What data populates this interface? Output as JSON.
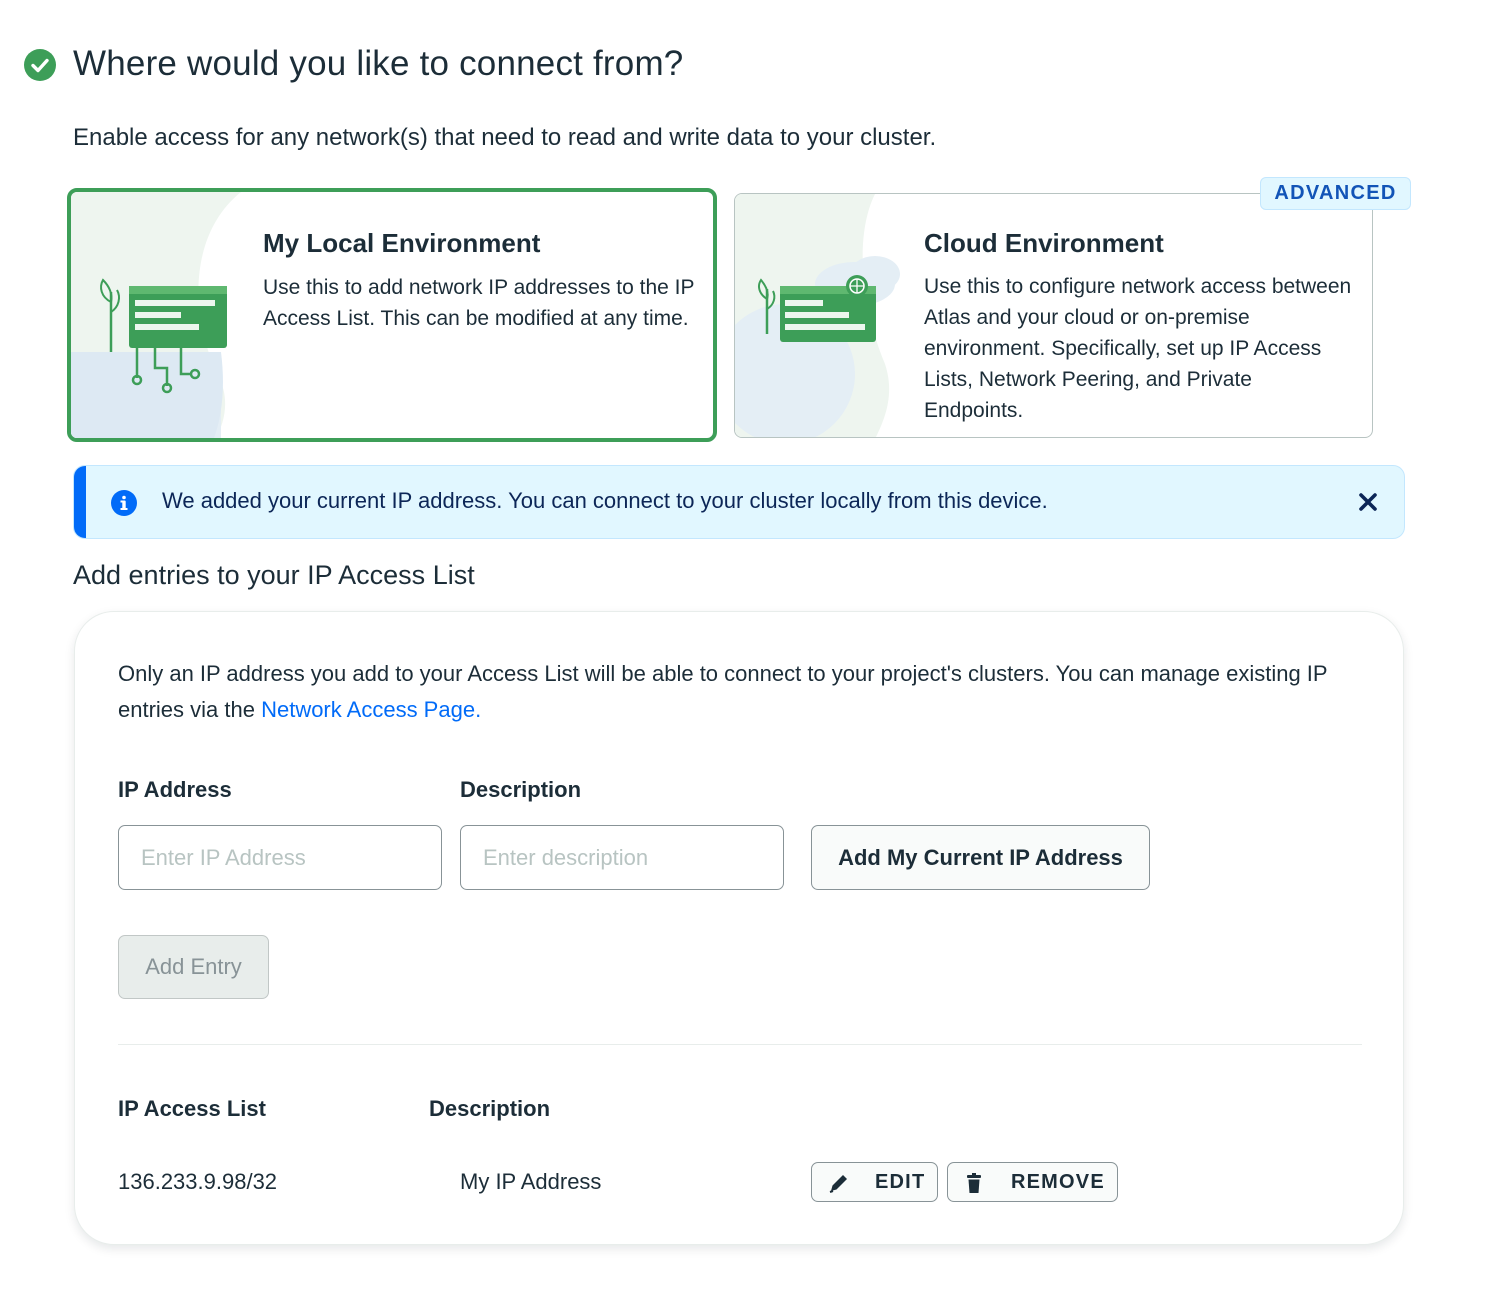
{
  "header": {
    "title": "Where would you like to connect from?",
    "subtitle": "Enable access for any network(s) that need to read and write data to your cluster."
  },
  "environments": [
    {
      "title": "My Local Environment",
      "description": "Use this to add network IP addresses to the IP Access List. This can be modified at any time.",
      "selected": true
    },
    {
      "title": "Cloud Environment",
      "description": "Use this to configure network access between Atlas and your cloud or on-premise environment. Specifically, set up IP Access Lists, Network Peering, and Private Endpoints.",
      "badge": "ADVANCED",
      "selected": false
    }
  ],
  "banner": {
    "text": "We added your current IP address. You can connect to your cluster locally from this device."
  },
  "section_title": "Add entries to your IP Access List",
  "panel": {
    "intro_text": "Only an IP address you add to your Access List will be able to connect to your project's clusters. You can manage existing IP entries via the ",
    "intro_link": "Network Access Page.",
    "ip_label": "IP Address",
    "ip_placeholder": "Enter IP Address",
    "ip_value": "",
    "desc_label": "Description",
    "desc_placeholder": "Enter description",
    "desc_value": "",
    "add_current_ip_label": "Add My Current IP Address",
    "add_entry_label": "Add Entry"
  },
  "access_list": {
    "columns": [
      "IP Access List",
      "Description"
    ],
    "rows": [
      {
        "ip": "136.233.9.98/32",
        "description": "My IP Address",
        "edit_label": "EDIT",
        "remove_label": "REMOVE"
      }
    ]
  },
  "colors": {
    "selected_border": "#3d9e58",
    "link": "#016bf8",
    "banner_bg": "#e1f7ff",
    "banner_accent": "#016bf8",
    "badge_text": "#1254b7"
  }
}
